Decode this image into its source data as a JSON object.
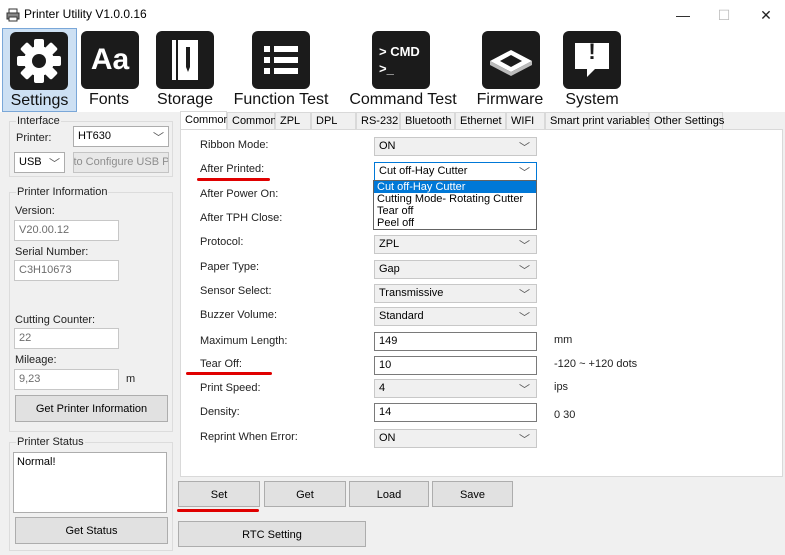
{
  "window": {
    "title": "Printer Utility  V1.0.0.16",
    "minimize": "—",
    "maximize": "☐",
    "close": "✕"
  },
  "toolbar": [
    {
      "label": "Settings",
      "icon": "gear-icon"
    },
    {
      "label": "Fonts",
      "icon": "fonts-aa-icon"
    },
    {
      "label": "Storage",
      "icon": "storage-notebook-icon"
    },
    {
      "label": "Function Test",
      "icon": "list-icon"
    },
    {
      "label": "Command Test",
      "icon": "command-prompt-icon"
    },
    {
      "label": "Firmware",
      "icon": "chip-icon"
    },
    {
      "label": "System",
      "icon": "exclamation-message-icon"
    }
  ],
  "icon_text": {
    "fonts": "Aa",
    "cmd": "> CMD",
    "cursor": ">_",
    "system": "!"
  },
  "interface": {
    "title": "Interface",
    "printer_label": "Printer:",
    "printer_value": "HT630",
    "port_value": "USB",
    "auto_button": "Auto Configure USB Pc"
  },
  "printer_info": {
    "title": "Printer Information",
    "version_label": "Version:",
    "version_value": "V20.00.12",
    "serial_label": "Serial Number:",
    "serial_value": "C3H10673",
    "cutting_label": "Cutting Counter:",
    "cutting_value": "22",
    "mileage_label": "Mileage:",
    "mileage_value": "9,23",
    "mileage_unit": "m",
    "get_info_button": "Get Printer Information"
  },
  "printer_status": {
    "title": "Printer Status",
    "text": "Normal!",
    "get_status_button": "Get Status"
  },
  "tabs": [
    "Common",
    "Common",
    "ZPL",
    "DPL",
    "RS-232",
    "Bluetooth",
    "Ethernet",
    "WIFI",
    "Smart print variables",
    "Other Settings"
  ],
  "fields": {
    "ribbon_mode": {
      "label": "Ribbon Mode:",
      "value": "ON"
    },
    "after_printed": {
      "label": "After Printed:",
      "value": "Cut off-Hay Cutter"
    },
    "after_power_on": {
      "label": "After Power On:"
    },
    "after_tph_close": {
      "label": "After TPH Close:"
    },
    "protocol": {
      "label": "Protocol:",
      "value": "ZPL"
    },
    "paper_type": {
      "label": "Paper Type:",
      "value": "Gap"
    },
    "sensor_select": {
      "label": "Sensor Select:",
      "value": "Transmissive"
    },
    "buzzer_volume": {
      "label": "Buzzer Volume:",
      "value": "Standard"
    },
    "maximum_length": {
      "label": "Maximum Length:",
      "value": "149",
      "unit": "mm"
    },
    "tear_off": {
      "label": "Tear Off:",
      "value": "10",
      "unit": "-120 ~ +120 dots"
    },
    "print_speed": {
      "label": "Print Speed:",
      "value": "4",
      "unit": "ips"
    },
    "density": {
      "label": "Density:",
      "value": "14",
      "unit": "0  30"
    },
    "reprint_when_error": {
      "label": "Reprint When Error:",
      "value": "ON"
    }
  },
  "after_printed_options": [
    "Cut off-Hay Cutter",
    "Cutting Mode- Rotating Cutter",
    "Tear off",
    "Peel off"
  ],
  "actions": {
    "set": "Set",
    "get": "Get",
    "load": "Load",
    "save": "Save",
    "rtc": "RTC Setting"
  },
  "colors": {
    "accent": "#0078d7",
    "highlight_line": "#e00000",
    "active_tool": "#cde0f3"
  }
}
